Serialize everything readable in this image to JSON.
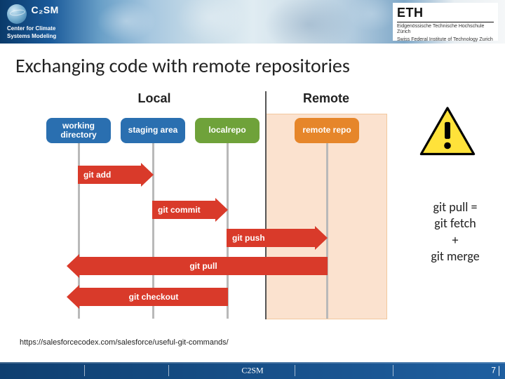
{
  "header": {
    "logo_title": "C₂SM",
    "logo_tag1": "Center for Climate",
    "logo_tag2": "Systems Modeling",
    "eth_name": "ETH",
    "eth_line1": "Eidgenössische Technische Hochschule Zürich",
    "eth_line2": "Swiss Federal Institute of Technology Zurich"
  },
  "title": "Exchanging code with remote repositories",
  "diagram": {
    "section_local": "Local",
    "section_remote": "Remote",
    "pill_working": "working directory",
    "pill_staging": "staging area",
    "pill_localrepo": "localrepo",
    "pill_remoterepo": "remote repo",
    "arrow_add": "git add",
    "arrow_commit": "git commit",
    "arrow_push": "git push",
    "arrow_pull": "git pull",
    "arrow_checkout": "git checkout"
  },
  "note": {
    "l1": "git pull =",
    "l2": "git fetch",
    "l3": "+",
    "l4": "git merge"
  },
  "citation": "https://salesforcecodex.com/salesforce/useful-git-commands/",
  "footer": {
    "center": "C2SM",
    "page": "7"
  }
}
